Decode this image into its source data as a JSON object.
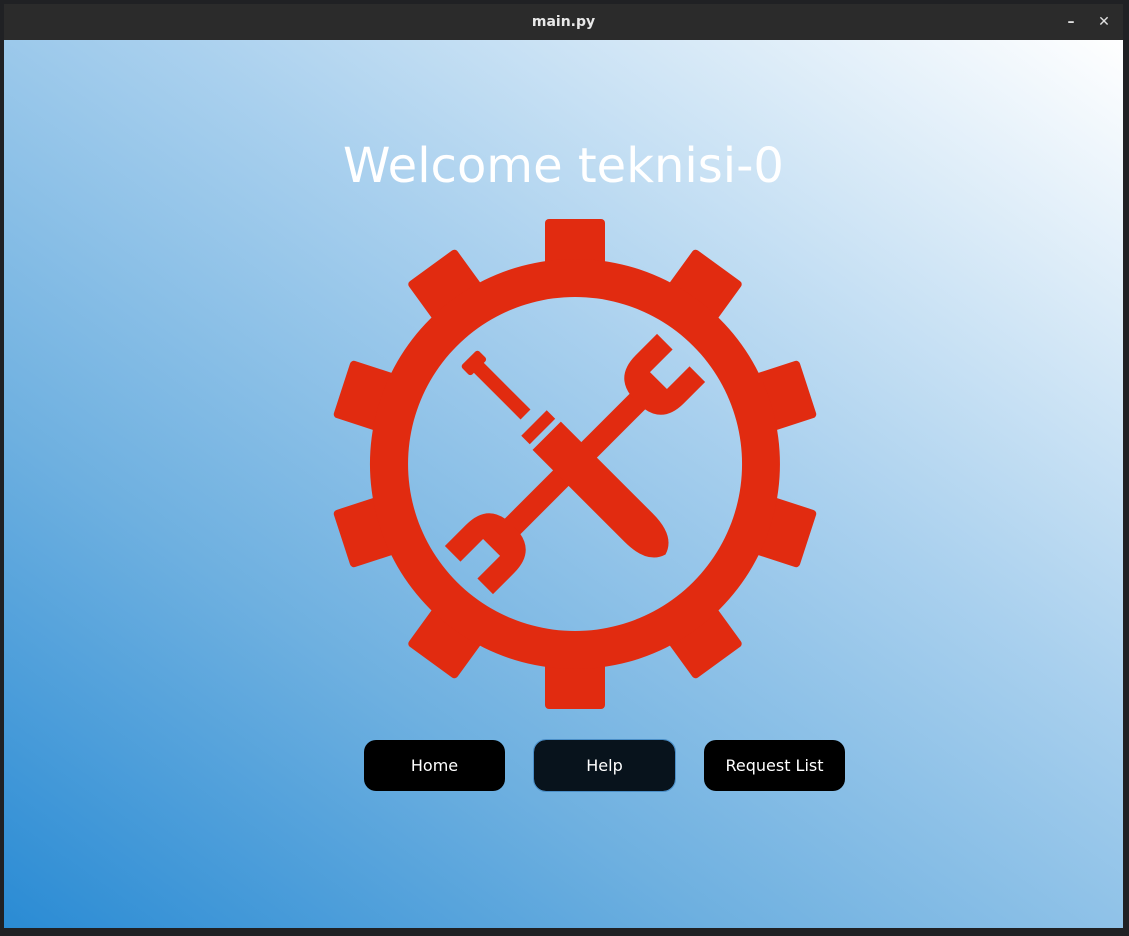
{
  "window": {
    "title": "main.py",
    "minimize_label": "–",
    "close_label": "✕"
  },
  "main": {
    "welcome_text": "Welcome teknisi-0",
    "logo_icon": "gear-wrench-screwdriver-icon",
    "buttons": {
      "home": "Home",
      "help": "Help",
      "request_list": "Request List"
    }
  },
  "colors": {
    "logo_red": "#e12b10",
    "button_bg": "#000000",
    "gradient_start": "#2a8bd4",
    "gradient_end": "#ffffff"
  }
}
